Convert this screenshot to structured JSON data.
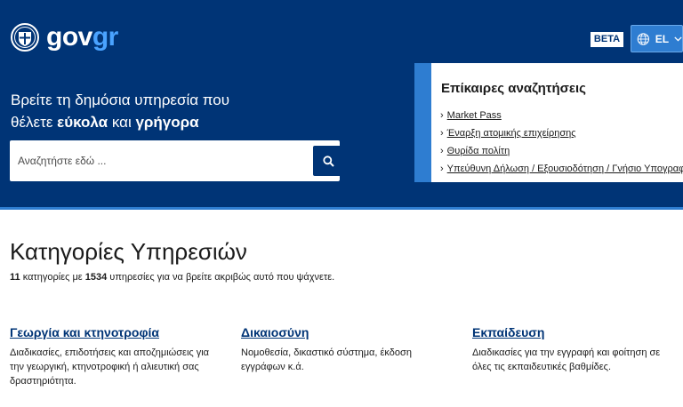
{
  "header": {
    "logo_gov": "gov",
    "logo_gr": "gr",
    "beta": "BETA",
    "lang": "EL"
  },
  "hero": {
    "line1": "Βρείτε τη δημόσια υπηρεσία που",
    "line2_pre": "θέλετε ",
    "line2_bold1": "εύκολα",
    "line2_mid": " και ",
    "line2_bold2": "γρήγορα",
    "search_placeholder": "Αναζητήστε εδώ ..."
  },
  "trending": {
    "title": "Επίκαιρες αναζητήσεις",
    "items": [
      "Market Pass",
      "Έναρξη ατομικής επιχείρησης",
      "Θυρίδα πολίτη",
      "Υπεύθυνη Δήλωση / Εξουσιοδότηση / Γνήσιο Υπογραφής"
    ]
  },
  "categories": {
    "title": "Κατηγορίες Υπηρεσιών",
    "count_categories": "11",
    "text_mid": " κατηγορίες με ",
    "count_services": "1534",
    "text_end": " υπηρεσίες για να βρείτε ακριβώς αυτό που ψάχνετε.",
    "items": [
      {
        "name": "Γεωργία και κτηνοτροφία",
        "desc": "Διαδικασίες, επιδοτήσεις και αποζημιώσεις για την γεωργική, κτηνοτροφική ή αλιευτική σας δραστηριότητα."
      },
      {
        "name": "Δικαιοσύνη",
        "desc": "Νομοθεσία, δικαστικό σύστημα, έκδοση εγγράφων κ.ά."
      },
      {
        "name": "Εκπαίδευση",
        "desc": "Διαδικασίες για την εγγραφή και φοίτηση σε όλες τις εκπαιδευτικές βαθμίδες."
      }
    ]
  },
  "colors": {
    "brand_blue": "#003476",
    "accent_blue": "#2e7dd1",
    "logo_accent": "#4aa3ff"
  }
}
